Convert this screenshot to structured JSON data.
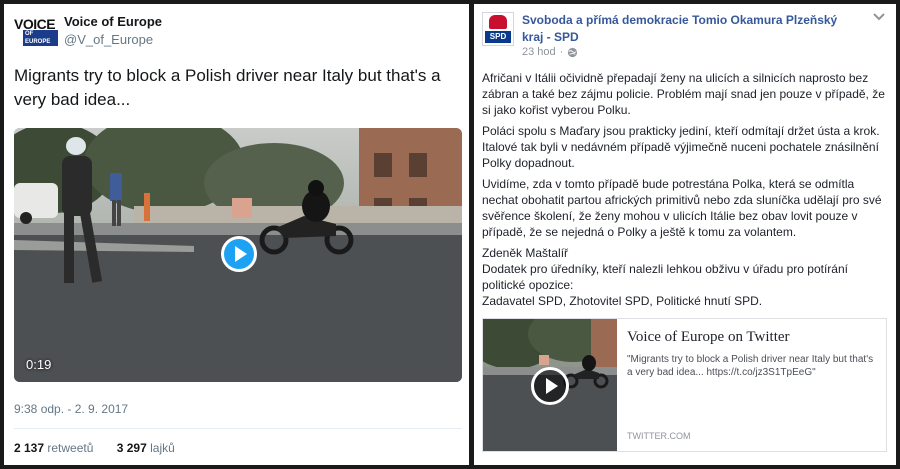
{
  "tweet": {
    "author_name": "Voice of Europe",
    "author_handle": "@V_of_Europe",
    "logo_line1": "VOICE",
    "logo_line2": "OF EUROPE",
    "text": "Migrants try to block a Polish driver near Italy but that's a very bad idea...",
    "video_duration": "0:19",
    "timestamp": "9:38 odp. - 2. 9. 2017",
    "retweets_count": "2 137",
    "retweets_label": "retweetů",
    "likes_count": "3 297",
    "likes_label": "lajků",
    "icons": {
      "play": "play-icon"
    }
  },
  "fb_post": {
    "page_name": "Svoboda a přímá demokracie Tomio Okamura Plzeňský kraj - SPD",
    "logo_text": "SPD",
    "time_ago": "23 hod",
    "audience_icon": "globe-icon",
    "paragraphs": [
      "Afričani v Itálii očividně přepadají ženy na ulicích a silnicích naprosto bez zábran a také bez zájmu policie. Problém mají snad jen pouze v případě, že si jako kořist vyberou Polku.",
      "Poláci spolu s Maďary jsou prakticky jediní, kteří odmítají držet ústa a krok. Italové tak byli v nedávném případě výjimečně nuceni pochatele znásilnění Polky dopadnout.",
      "Uvidíme, zda v tomto případě bude potrestána Polka, která se odmítla nechat obohatit partou afrických primitivů nebo zda sluníčka udělají pro své svěřence školení, že ženy mohou v ulicích Itálie bez obav lovit pouze v případě, že se nejedná o Polky a ještě k tomu za volantem.",
      "Zdeněk Maštalíř\nDodatek pro úředníky, kteří nalezli lehkou obživu v úřadu pro potírání politické opozice:\nZadavatel SPD, Zhotovitel SPD, Politické hnutí SPD."
    ],
    "link_card": {
      "title": "Voice of Europe on Twitter",
      "description": "\"Migrants try to block a Polish driver near Italy but that's a very bad idea... https://t.co/jz3S1TpEeG\"",
      "domain": "TWITTER.COM"
    }
  },
  "colors": {
    "twitter_blue": "#1da1f2",
    "facebook_link": "#365899",
    "spd_red": "#c8102e",
    "spd_blue": "#0b3a8c"
  }
}
